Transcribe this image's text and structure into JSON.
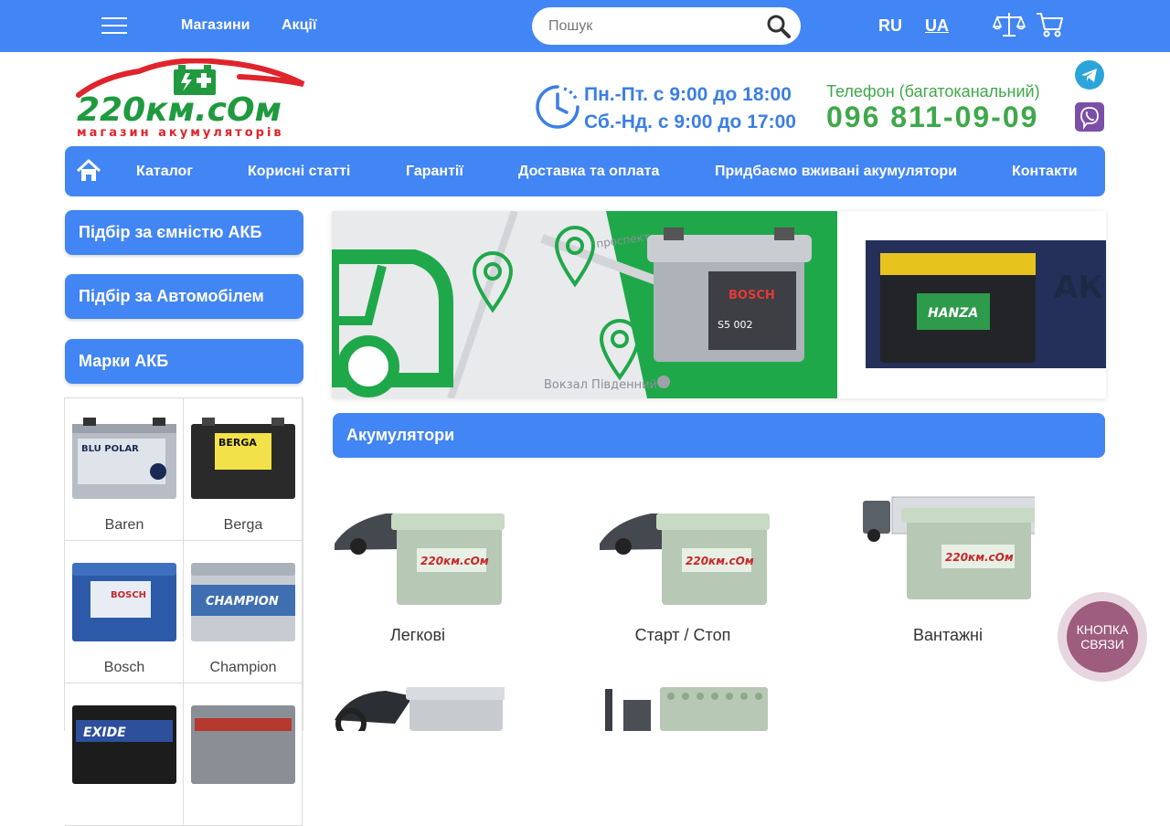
{
  "topbar": {
    "nav": [
      "Магазини",
      "Акції"
    ],
    "search_placeholder": "Пошук",
    "languages": [
      "RU",
      "UA"
    ],
    "active_language": "UA"
  },
  "header": {
    "logo_text": "220км.сОм",
    "logo_tagline": "магазин акумуляторів",
    "hours": [
      "Пн.-Пт. с 9:00 до 18:00",
      "Сб.-Нд. с 9:00 до 17:00"
    ],
    "phone_label": "Телефон (багатоканальний)",
    "phone": "096 811-09-09"
  },
  "main_nav": [
    "Каталог",
    "Корисні статті",
    "Гарантії",
    "Доставка та оплата",
    "Придбаємо вживані акумулятори",
    "Контакти"
  ],
  "sidebar": {
    "buttons": [
      "Підбір за ємністю АКБ",
      "Підбір за Автомобілем",
      "Марки АКБ"
    ],
    "brands": [
      {
        "name": "Baren",
        "label": "BLU POLAR",
        "color": "#b7bdc6"
      },
      {
        "name": "Berga",
        "label": "BERGA",
        "color": "#2a2a2a"
      },
      {
        "name": "Bosch",
        "label": "BOSCH",
        "color": "#2c5aa8"
      },
      {
        "name": "Champion",
        "label": "CHAMPION",
        "color": "#3f6fb0"
      },
      {
        "name": "",
        "label": "EXIDE",
        "color": "#1c1c1c"
      },
      {
        "name": "",
        "label": "",
        "color": "#8a8f96"
      }
    ]
  },
  "banner": {
    "street_1": "проспект",
    "street_2": "Вокзал Південний",
    "battery_1": "BOSCH",
    "battery_1_model": "S5 002",
    "battery_2": "HANZA",
    "side_text": "АККУ",
    "accent": "#1fa84a"
  },
  "section": {
    "title": "Акумулятори",
    "categories": [
      "Легкові",
      "Старт / Стоп",
      "Вантажні",
      "",
      ""
    ]
  },
  "contact_button": {
    "line1": "КНОПКА",
    "line2": "СВЯЗИ"
  },
  "colors": {
    "primary": "#4285f4",
    "green": "#3fa84a",
    "logo_red": "#e0242b",
    "logo_green": "#1f9a3f"
  }
}
